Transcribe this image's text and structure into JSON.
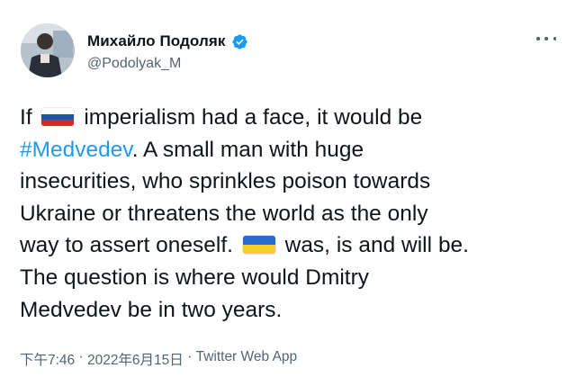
{
  "author": {
    "display_name": "Михайло Подоляк",
    "handle": "@Podolyak_M",
    "verified_icon": "verified-badge-icon",
    "avatar_icon": "profile-photo"
  },
  "more_icon": "more-options-icon",
  "tweet": {
    "line1_pre": "If",
    "line1_post": "imperialism had a face, it would be",
    "hashtag": "#Medvedev",
    "line2_post": ". A small man with huge",
    "line3": "insecurities, who sprinkles poison towards",
    "line4": "Ukraine or threatens the world as the only",
    "line5_pre": "way to assert oneself.",
    "line5_post": "was, is and will be.",
    "line6": "The question is where would Dmitry",
    "line7": "Medvedev be in two years.",
    "flag_russia": "russia-flag-emoji",
    "flag_ukraine": "ukraine-flag-emoji"
  },
  "meta": {
    "time": "下午7:46",
    "sep1": " · ",
    "date": "2022年6月15日",
    "sep2": " · ",
    "source": "Twitter Web App"
  },
  "colors": {
    "link": "#1d9bf0",
    "secondary_text": "#536471",
    "verified": "#1d9bf0"
  }
}
